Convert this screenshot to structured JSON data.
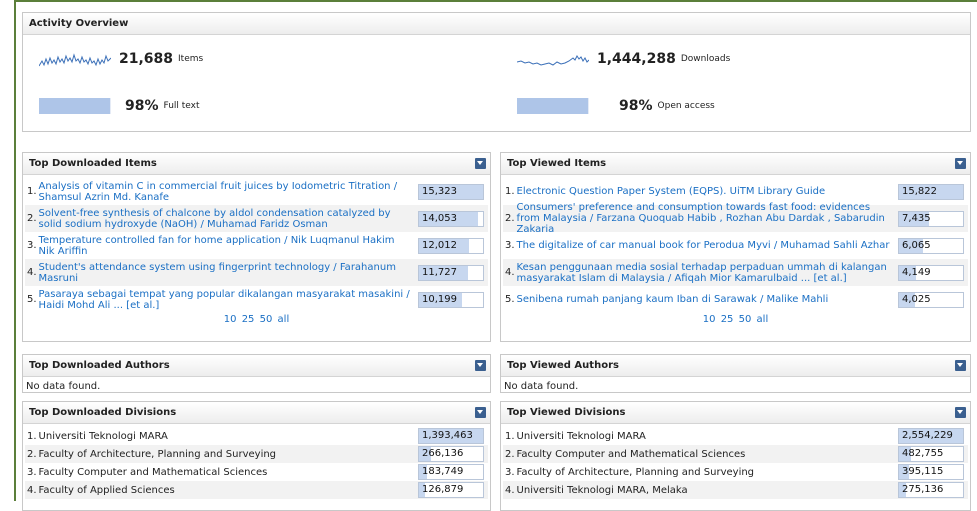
{
  "overview": {
    "title": "Activity Overview",
    "items_count": "21,688",
    "items_label": "Items",
    "downloads_count": "1,444,288",
    "downloads_label": "Downloads",
    "fulltext_pct": "98%",
    "fulltext_label": "Full text",
    "fulltext_level": 0.98,
    "openaccess_pct": "98%",
    "openaccess_label": "Open access",
    "openaccess_level": 0.98,
    "spark_color": "#3a6fb8",
    "bar_color": "#aec5e8"
  },
  "top_downloaded_items": {
    "title": "Top Downloaded Items",
    "rows": [
      {
        "num": "1.",
        "text": "Analysis of vitamin C in commercial fruit juices by Iodometric Titration / Shamsul Azrin Md. Kanafe",
        "value": "15,323",
        "level": 1.0
      },
      {
        "num": "2.",
        "text": "Solvent-free synthesis of chalcone by aldol condensation catalyzed by solid sodium hydroxyde (NaOH) / Muhamad Faridz Osman",
        "value": "14,053",
        "level": 0.92
      },
      {
        "num": "3.",
        "text": "Temperature controlled fan for home application / Nik Luqmanul Hakim Nik Ariffin",
        "value": "12,012",
        "level": 0.78
      },
      {
        "num": "4.",
        "text": "Student's attendance system using fingerprint technology / Farahanum Masruni",
        "value": "11,727",
        "level": 0.77
      },
      {
        "num": "5.",
        "text": "Pasaraya sebagai tempat yang popular dikalangan masyarakat masakini / Haidi Mohd Ali ... [et al.]",
        "value": "10,199",
        "level": 0.67
      }
    ],
    "pager": [
      "10",
      "25",
      "50",
      "all"
    ]
  },
  "top_viewed_items": {
    "title": "Top Viewed Items",
    "rows": [
      {
        "num": "1.",
        "text": "Electronic Question Paper System (EQPS). UiTM Library Guide",
        "value": "15,822",
        "level": 1.0
      },
      {
        "num": "2.",
        "text": "Consumers' preference and consumption towards fast food: evidences from Malaysia / Farzana Quoquab Habib , Rozhan Abu Dardak , Sabarudin Zakaria",
        "value": "7,435",
        "level": 0.47
      },
      {
        "num": "3.",
        "text": "The digitalize of car manual book for Perodua Myvi / Muhamad Sahli Azhar",
        "value": "6,065",
        "level": 0.38
      },
      {
        "num": "4.",
        "text": "Kesan penggunaan media sosial terhadap perpaduan ummah di kalangan masyarakat Islam di Malaysia / Afiqah Mior Kamarulbaid ... [et al.]",
        "value": "4,149",
        "level": 0.26
      },
      {
        "num": "5.",
        "text": "Senibena rumah panjang kaum Iban di Sarawak / Malike Mahli",
        "value": "4,025",
        "level": 0.25
      }
    ],
    "pager": [
      "10",
      "25",
      "50",
      "all"
    ]
  },
  "top_downloaded_authors": {
    "title": "Top Downloaded Authors",
    "empty": "No data found."
  },
  "top_viewed_authors": {
    "title": "Top Viewed Authors",
    "empty": "No data found."
  },
  "top_downloaded_divisions": {
    "title": "Top Downloaded Divisions",
    "rows": [
      {
        "num": "1.",
        "text": "Universiti Teknologi MARA",
        "value": "1,393,463",
        "level": 1.0
      },
      {
        "num": "2.",
        "text": "Faculty of Architecture, Planning and Surveying",
        "value": "266,136",
        "level": 0.19
      },
      {
        "num": "3.",
        "text": "Faculty Computer and Mathematical Sciences",
        "value": "183,749",
        "level": 0.13
      },
      {
        "num": "4.",
        "text": "Faculty of Applied Sciences",
        "value": "126,879",
        "level": 0.09
      }
    ]
  },
  "top_viewed_divisions": {
    "title": "Top Viewed Divisions",
    "rows": [
      {
        "num": "1.",
        "text": "Universiti Teknologi MARA",
        "value": "2,554,229",
        "level": 1.0
      },
      {
        "num": "2.",
        "text": "Faculty Computer and Mathematical Sciences",
        "value": "482,755",
        "level": 0.19
      },
      {
        "num": "3.",
        "text": "Faculty of Architecture, Planning and Surveying",
        "value": "395,115",
        "level": 0.15
      },
      {
        "num": "4.",
        "text": "Universiti Teknologi MARA, Melaka",
        "value": "275,136",
        "level": 0.11
      }
    ]
  }
}
